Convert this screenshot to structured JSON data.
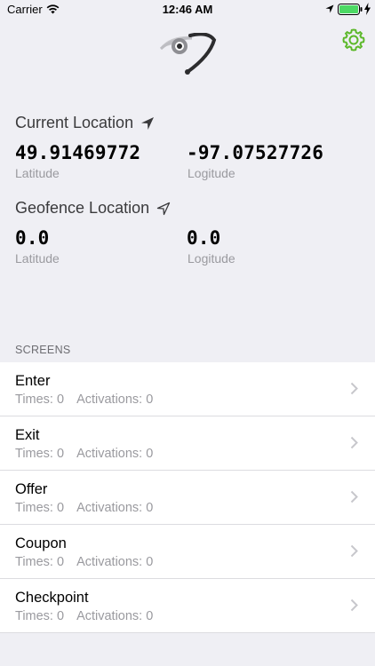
{
  "status_bar": {
    "carrier": "Carrier",
    "time": "12:46 AM",
    "icons": [
      "wifi-icon",
      "location-arrow-icon",
      "battery-icon",
      "charging-bolt-icon"
    ],
    "battery_color": "#4cd964"
  },
  "header": {
    "logo_icon": "eye-swoosh-logo",
    "settings_icon": "gear-icon",
    "accent_color": "#5cb82a"
  },
  "current_location": {
    "title": "Current Location",
    "icon": "navigation-arrow-icon",
    "latitude": "49.91469772",
    "latitude_label": "Latitude",
    "longitude": "-97.07527726",
    "longitude_label": "Logitude"
  },
  "geofence_location": {
    "title": "Geofence Location",
    "icon": "navigation-arrow-outline-icon",
    "latitude": "0.0",
    "latitude_label": "Latitude",
    "longitude": "0.0",
    "longitude_label": "Logitude"
  },
  "screens": {
    "header": "SCREENS",
    "items": [
      {
        "title": "Enter",
        "times": "Times: 0",
        "activations": "Activations: 0"
      },
      {
        "title": "Exit",
        "times": "Times: 0",
        "activations": "Activations: 0"
      },
      {
        "title": "Offer",
        "times": "Times: 0",
        "activations": "Activations: 0"
      },
      {
        "title": "Coupon",
        "times": "Times: 0",
        "activations": "Activations: 0"
      },
      {
        "title": "Checkpoint",
        "times": "Times: 0",
        "activations": "Activations: 0"
      }
    ]
  }
}
